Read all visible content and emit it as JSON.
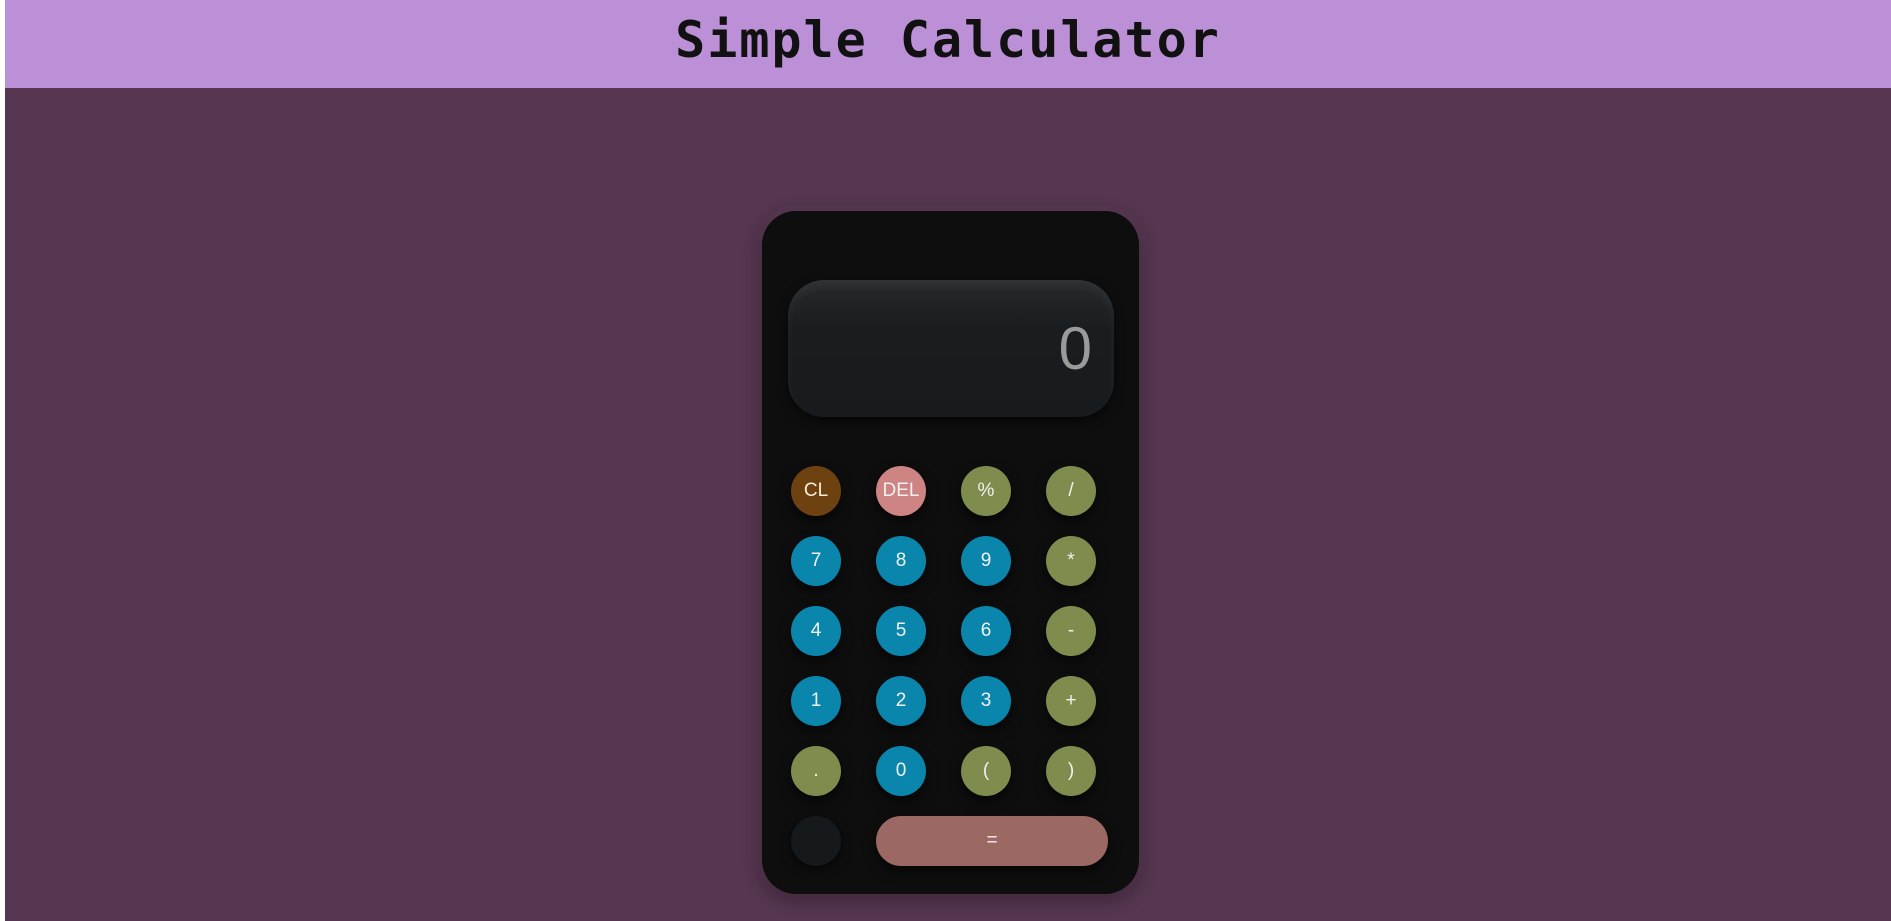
{
  "header": {
    "title": "Simple Calculator"
  },
  "display": {
    "value": "0"
  },
  "buttons": {
    "clear": "CL",
    "delete": "DEL",
    "percent": "%",
    "divide": "/",
    "seven": "7",
    "eight": "8",
    "nine": "9",
    "multiply": "*",
    "four": "4",
    "five": "5",
    "six": "6",
    "subtract": "-",
    "one": "1",
    "two": "2",
    "three": "3",
    "add": "+",
    "decimal": ".",
    "zero": "0",
    "open_paren": "(",
    "close_paren": ")",
    "equals": "="
  },
  "theme_toggle": {
    "icon": "moon-icon"
  },
  "colors": {
    "background": "#563650",
    "header": "#bc90d6",
    "calculator_body": "#0e0e0e",
    "number_button": "#0a86ad",
    "operator_button": "#7e8d4e",
    "clear_button": "#6e4210",
    "delete_button": "#cd8483",
    "equals_button": "#9b6864",
    "moon": "#6e4210"
  }
}
